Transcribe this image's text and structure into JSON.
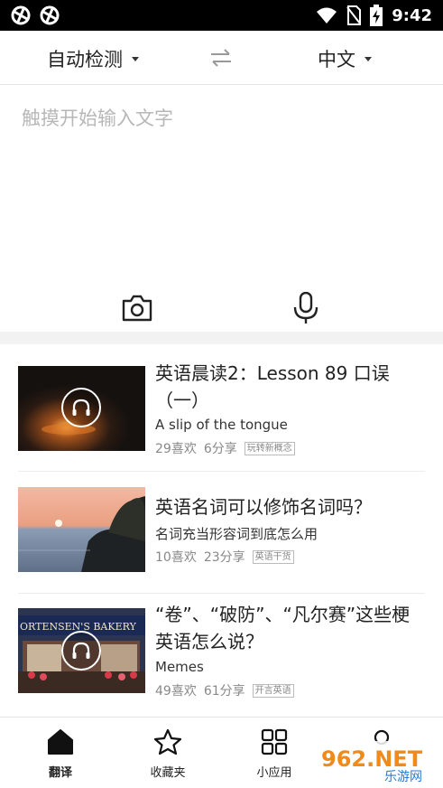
{
  "status_bar": {
    "time": "9:42",
    "left_icons": [
      "app-notification-icon",
      "app-notification-icon"
    ],
    "right_icons": [
      "wifi-icon",
      "no-sim-icon",
      "battery-charging-icon"
    ]
  },
  "language_bar": {
    "source": "自动检测",
    "target": "中文",
    "swap_icon": "swap-arrows-icon"
  },
  "input": {
    "placeholder": "触摸开始输入文字",
    "camera_icon": "camera-icon",
    "mic_icon": "microphone-icon"
  },
  "feed": [
    {
      "title": "英语晨读2：Lesson 89 口误（一）",
      "subtitle": "A slip of the tongue",
      "likes": "29喜欢",
      "shares": "6分享",
      "tag": "玩转新概念",
      "has_audio": true
    },
    {
      "title": "英语名词可以修饰名词吗？",
      "subtitle": "名词充当形容词到底怎么用",
      "likes": "10喜欢",
      "shares": "23分享",
      "tag": "英语干货",
      "has_audio": false
    },
    {
      "title": "“卷”、“破防”、“凡尔赛”这些梗英语怎么说？",
      "subtitle": "Memes",
      "likes": "49喜欢",
      "shares": "61分享",
      "tag": "开言英语",
      "has_audio": true,
      "thumb_sign": "ORTENSEN'S BAKERY"
    }
  ],
  "bottom_nav": [
    {
      "label": "翻译",
      "icon": "home-icon",
      "active": true
    },
    {
      "label": "收藏夹",
      "icon": "star-icon",
      "active": false
    },
    {
      "label": "小应用",
      "icon": "apps-grid-icon",
      "active": false
    },
    {
      "label": "",
      "icon": "profile-icon",
      "active": false
    }
  ],
  "watermark": {
    "text": "962.NET",
    "subtext": "乐游网"
  }
}
